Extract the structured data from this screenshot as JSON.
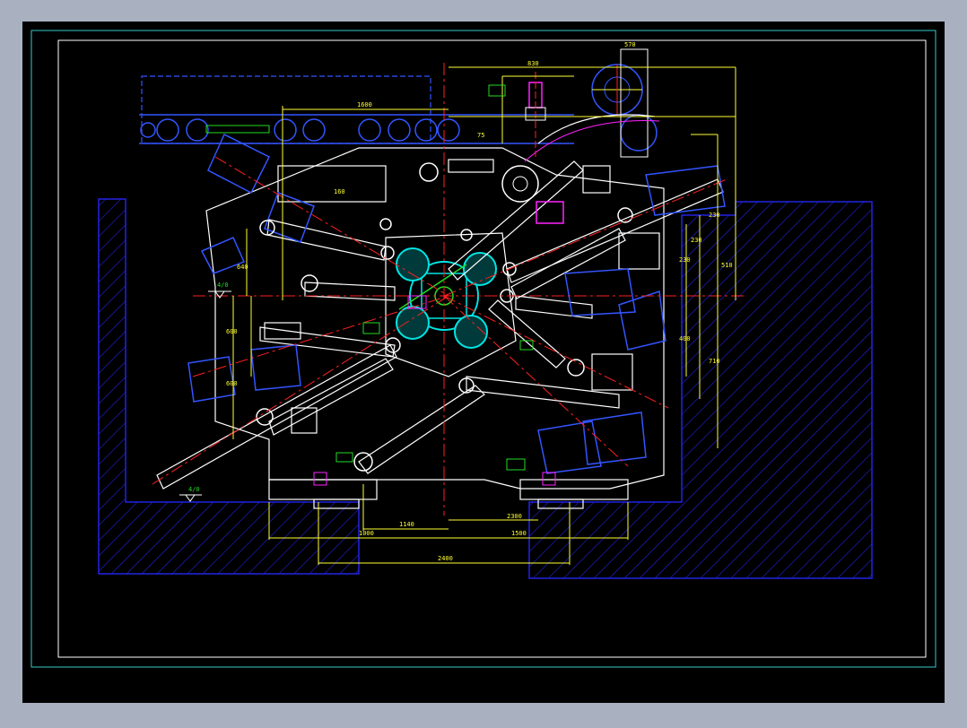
{
  "drawing": {
    "colors": {
      "background": "#000000",
      "outer_frame": "#5a6275",
      "frame_cyan": "#33cccc",
      "frame_white": "#ffffff",
      "hatch": "#2323e6",
      "centerline": "#ff2020",
      "dimension": "#ffff33",
      "part": "#ffffff",
      "part_blue": "#3355ff",
      "accent_cyan": "#00e5e5",
      "accent_green": "#22dd22",
      "accent_magenta": "#ff22ff"
    },
    "dimensions": {
      "top": [
        "1600",
        "830",
        "570",
        "75",
        "160"
      ],
      "right": [
        "230",
        "230",
        "230",
        "400",
        "710",
        "510"
      ],
      "left": [
        "640",
        "600",
        "600"
      ],
      "bottom": [
        "1140",
        "2300",
        "1000",
        "1500",
        "2400"
      ],
      "level": [
        "4/0",
        "4/0"
      ]
    }
  }
}
